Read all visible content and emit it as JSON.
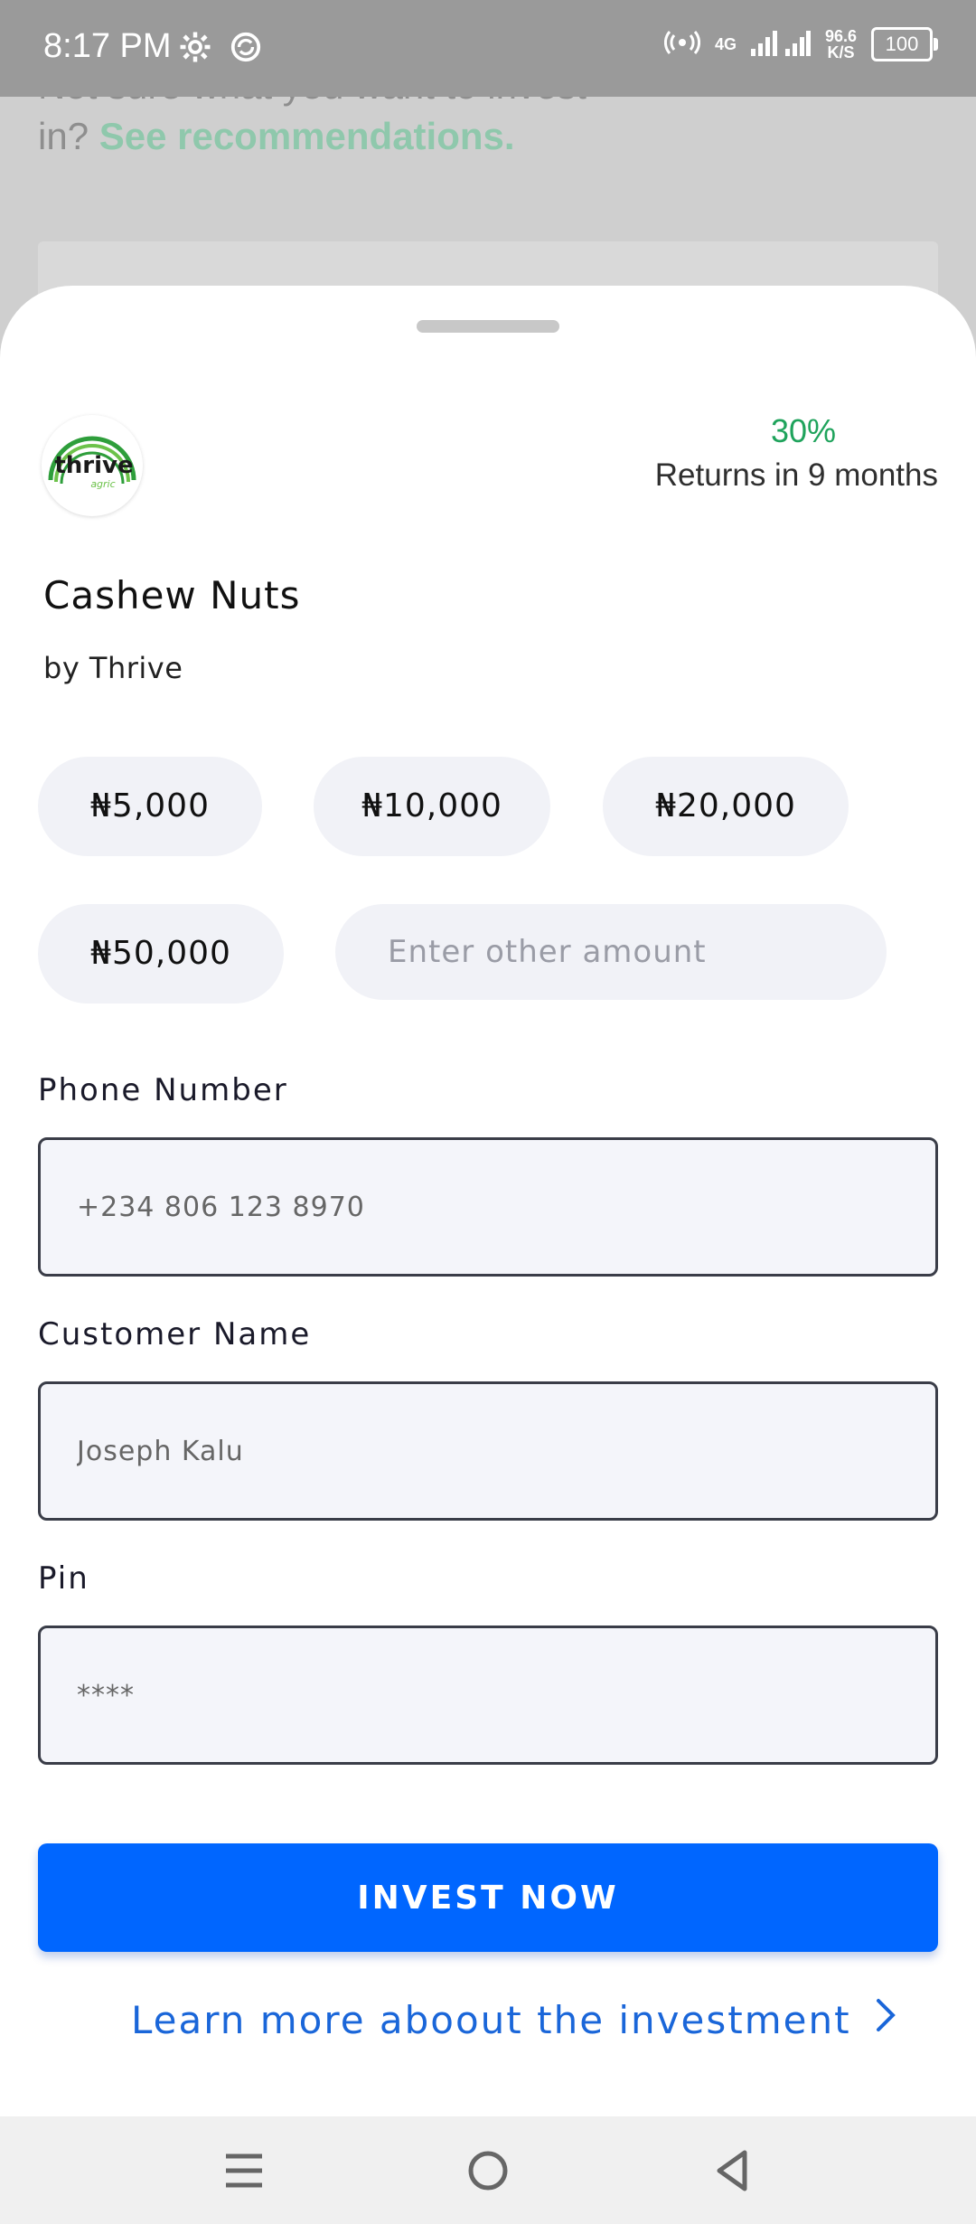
{
  "status_bar": {
    "time": "8:17 PM",
    "net_speed_value": "96.6",
    "net_speed_unit": "K/S",
    "network_type": "4G",
    "battery": "100"
  },
  "background_page": {
    "prompt_line1": "Not sure what you want to invest",
    "prompt_line2": "in? ",
    "recommendations_link": "See recommendations."
  },
  "investment": {
    "logo_text": "thrive",
    "logo_subtext": "agric",
    "returns_percent": "30%",
    "returns_label": "Returns in 9 months",
    "product_name": "Cashew Nuts",
    "provider": "by Thrive"
  },
  "amounts": {
    "options": [
      "₦5,000",
      "₦10,000",
      "₦20,000",
      "₦50,000"
    ],
    "other_placeholder": "Enter other amount"
  },
  "form": {
    "phone_label": "Phone Number",
    "phone_placeholder": "+234 806 123 8970",
    "name_label": "Customer Name",
    "name_placeholder": "Joseph Kalu",
    "pin_label": "Pin",
    "pin_placeholder": "****"
  },
  "actions": {
    "invest_label": "INVEST NOW",
    "learn_more_label": "Learn more aboout the investment"
  },
  "colors": {
    "primary_button": "#0066ff",
    "returns_green": "#1fa35c",
    "link_blue": "#1a66d9",
    "chip_bg": "#f1f2f7"
  },
  "icons": [
    "settings-icon",
    "sync-icon",
    "hotspot-icon",
    "signal-icon",
    "battery-icon",
    "chevron-right-icon",
    "menu-icon",
    "home-icon",
    "back-icon"
  ]
}
